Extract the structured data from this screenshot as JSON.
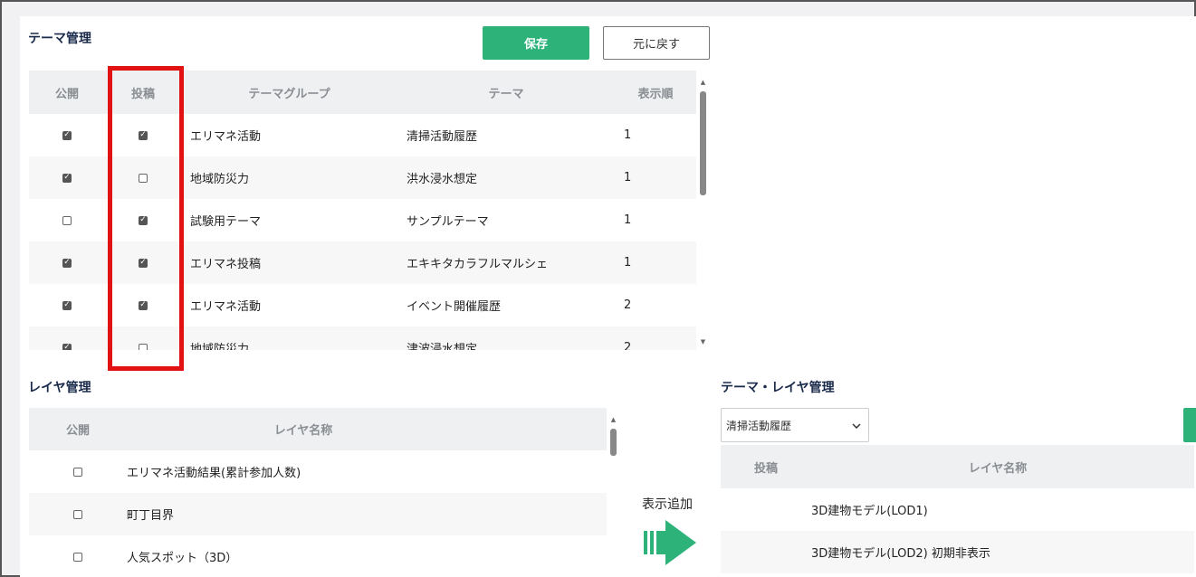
{
  "theme_management": {
    "title": "テーマ管理",
    "save_label": "保存",
    "revert_label": "元に戻す",
    "headers": {
      "public": "公開",
      "post": "投稿",
      "group": "テーマグループ",
      "theme": "テーマ",
      "order": "表示順"
    },
    "rows": [
      {
        "public": true,
        "post": true,
        "group": "エリマネ活動",
        "theme": "清掃活動履歴",
        "order": "1"
      },
      {
        "public": true,
        "post": false,
        "group": "地域防災力",
        "theme": "洪水浸水想定",
        "order": "1"
      },
      {
        "public": false,
        "post": true,
        "group": "試験用テーマ",
        "theme": "サンプルテーマ",
        "order": "1"
      },
      {
        "public": true,
        "post": true,
        "group": "エリマネ投稿",
        "theme": "エキキタカラフルマルシェ",
        "order": "1"
      },
      {
        "public": true,
        "post": true,
        "group": "エリマネ活動",
        "theme": "イベント開催履歴",
        "order": "2"
      },
      {
        "public": true,
        "post": false,
        "group": "地域防災力",
        "theme": "津波浸水想定",
        "order": "2"
      }
    ]
  },
  "layer_management": {
    "title": "レイヤ管理",
    "headers": {
      "public": "公開",
      "name": "レイヤ名称"
    },
    "rows": [
      {
        "public": false,
        "name": "エリマネ活動結果(累計参加人数)"
      },
      {
        "public": false,
        "name": "町丁目界"
      },
      {
        "public": false,
        "name": "人気スポット（3D）"
      }
    ]
  },
  "add_display": {
    "label": "表示追加"
  },
  "theme_layer_management": {
    "title": "テーマ・レイヤ管理",
    "selected_theme": "清掃活動履歴",
    "headers": {
      "post": "投稿",
      "name": "レイヤ名称"
    },
    "rows": [
      {
        "name": "3D建物モデル(LOD1)"
      },
      {
        "name": "3D建物モデル(LOD2) 初期非表示"
      }
    ]
  },
  "colors": {
    "accent": "#2db37a",
    "highlight": "#e31212",
    "header_bg": "#eef0f2"
  }
}
